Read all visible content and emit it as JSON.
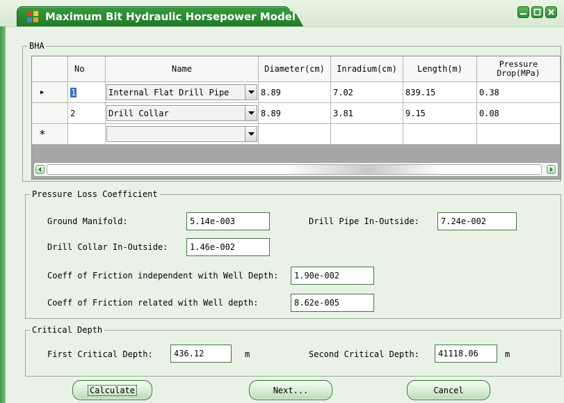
{
  "window": {
    "title": "Maximum Bit Hydraulic Horsepower Model"
  },
  "bha": {
    "legend": "BHA",
    "headers": [
      "No",
      "Name",
      "Diameter(cm)",
      "Inradium(cm)",
      "Length(m)",
      "Pressure\nDrop(MPa)"
    ],
    "rows": [
      {
        "no": "1",
        "name": "Internal Flat Drill Pipe",
        "diameter": "8.89",
        "inradium": "7.02",
        "length": "839.15",
        "pressure_drop": "0.38"
      },
      {
        "no": "2",
        "name": "Drill Collar",
        "diameter": "8.89",
        "inradium": "3.81",
        "length": "9.15",
        "pressure_drop": "0.08"
      }
    ],
    "new_row_marker": "*",
    "current_row_marker": "▶"
  },
  "pressure_loss": {
    "legend": "Pressure Loss Coefficient",
    "ground_manifold_label": "Ground Manifold:",
    "ground_manifold_value": "5.14e-003",
    "drill_pipe_label": "Drill Pipe In-Outside:",
    "drill_pipe_value": "7.24e-002",
    "drill_collar_label": "Drill Collar In-Outside:",
    "drill_collar_value": "1.46e-002",
    "coeff_indep_label": "Coeff of Friction independent with Well Depth:",
    "coeff_indep_value": "1.90e-002",
    "coeff_related_label": "Coeff of Friction related with Well depth:",
    "coeff_related_value": "8.62e-005"
  },
  "critical_depth": {
    "legend": "Critical Depth",
    "first_label": "First Critical Depth:",
    "first_value": "436.12",
    "first_unit": "m",
    "second_label": "Second Critical Depth:",
    "second_value": "41118.06",
    "second_unit": "m"
  },
  "buttons": {
    "calculate": "Calculate",
    "next": "Next...",
    "cancel": "Cancel"
  },
  "colors": {
    "title_green": "#2a8a2f",
    "accent_border": "#3c7a3c",
    "window_bg": "#eaf2e8"
  }
}
